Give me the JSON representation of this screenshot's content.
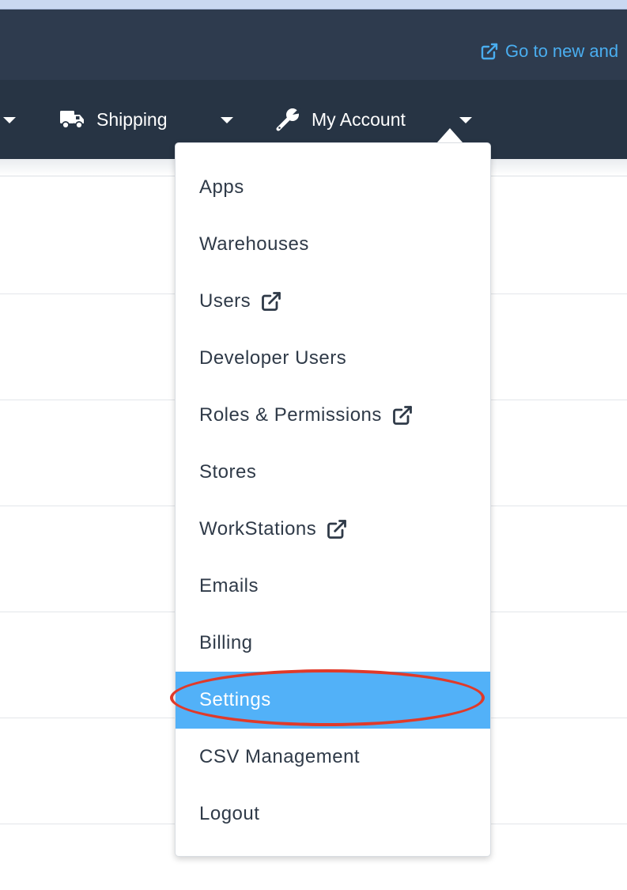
{
  "header": {
    "new_link_label": "Go to new and"
  },
  "navbar": {
    "items": [
      {
        "label": "Shipping",
        "icon": "truck-icon"
      },
      {
        "label": "My Account",
        "icon": "wrench-icon"
      }
    ]
  },
  "account_menu": {
    "items": [
      {
        "label": "Apps"
      },
      {
        "label": "Warehouses"
      },
      {
        "label": "Users",
        "external": true
      },
      {
        "label": "Developer Users"
      },
      {
        "label": "Roles & Permissions",
        "external": true
      },
      {
        "label": "Stores"
      },
      {
        "label": "WorkStations",
        "external": true
      },
      {
        "label": "Emails"
      },
      {
        "label": "Billing"
      },
      {
        "label": "Settings",
        "active": true
      },
      {
        "label": "CSV Management"
      },
      {
        "label": "Logout"
      }
    ]
  },
  "colors": {
    "header_bg": "#2e3b4e",
    "navbar_bg": "#273444",
    "link_blue": "#4aaef0",
    "active_item_bg": "#52b1f8",
    "annotation_red": "#e03a2a"
  }
}
